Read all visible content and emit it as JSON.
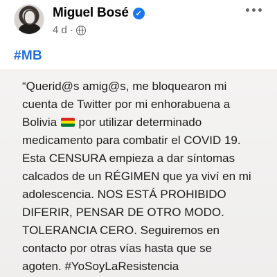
{
  "post": {
    "author": "Miguel Bosé",
    "verified_mark": "✓",
    "timestamp": "4 d",
    "separator": "·",
    "hashtag": "#MB",
    "text_before_flag": "“Querid@s amig@s, me bloquearon mi\ncuenta de Twitter por mi enhorabuena a\nBolivia ",
    "flag_icon": "bolivia-flag-icon",
    "text_after_flag": " por utilizar determinado\nmedicamento para combatir el COVID 19.\nEsta CENSURA empieza a dar síntomas\ncalcados de un RÉGIMEN que ya viví en mi\nadolescencia. NOS ESTÁ PROHIBIDO\nDIFERIR, PENSAR DE OTRO MODO.\nTOLERANCIA CERO. Seguiremos en\ncontacto por otras vías hasta que se\nagoten. #YoSoyLaResistencia"
  },
  "colors": {
    "hashtag": "#216fdb",
    "verified": "#1877f2",
    "meta": "#65676b",
    "card_background": "#f0efee"
  }
}
